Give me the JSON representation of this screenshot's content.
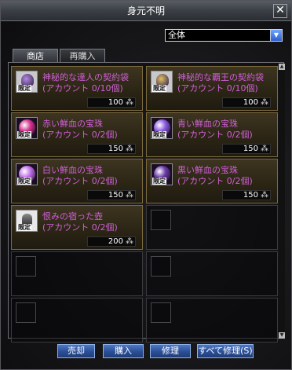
{
  "window": {
    "title": "身元不明",
    "close_label": "✕"
  },
  "filter": {
    "selected": "全体",
    "arrow": "▼"
  },
  "tabs": [
    {
      "label": "商店"
    },
    {
      "label": "再購入"
    }
  ],
  "items": [
    {
      "name": "神秘的な達人の契約袋",
      "count": "(アカウント 0/10個)",
      "price": "100",
      "badge": "限定",
      "icon": "purple-bag-icon",
      "color": "#b488e0"
    },
    {
      "name": "神秘的な覇王の契約袋",
      "count": "(アカウント 0/10個)",
      "price": "100",
      "badge": "限定",
      "icon": "gold-bag-icon",
      "color": "#e0c060"
    },
    {
      "name": "赤い鮮血の宝珠",
      "count": "(アカウント 0/2個)",
      "price": "150",
      "badge": "限定",
      "icon": "red-orb-icon",
      "color": "#d4328e"
    },
    {
      "name": "青い鮮血の宝珠",
      "count": "(アカウント 0/2個)",
      "price": "150",
      "badge": "限定",
      "icon": "blue-orb-icon",
      "color": "#8a5ae0"
    },
    {
      "name": "白い鮮血の宝珠",
      "count": "(アカウント 0/2個)",
      "price": "150",
      "badge": "限定",
      "icon": "white-orb-icon",
      "color": "#c070e8"
    },
    {
      "name": "黒い鮮血の宝珠",
      "count": "(アカウント 0/2個)",
      "price": "150",
      "badge": "限定",
      "icon": "black-orb-icon",
      "color": "#6a3aa8"
    },
    {
      "name": "恨みの宿った壺",
      "count": "(アカウント 0/2個)",
      "price": "200",
      "badge": "限定",
      "icon": "jar-icon",
      "color": "#777777"
    }
  ],
  "buttons": {
    "sell": "売却",
    "buy": "購入",
    "repair": "修理",
    "repair_all": "すべて修理(S)"
  },
  "scrollbar": {
    "up": "▲",
    "down": "▼"
  },
  "currency_icon": "feather-icon"
}
